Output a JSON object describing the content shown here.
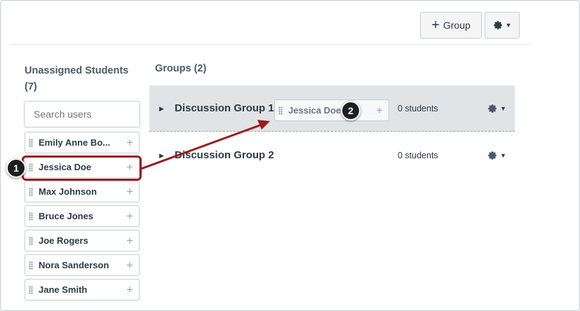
{
  "toolbar": {
    "add_group_label": "Group",
    "add_group_icon": "plus-icon",
    "settings_icon": "gear-icon"
  },
  "unassigned": {
    "title": "Unassigned Students (7)",
    "search_placeholder": "Search users",
    "students": [
      {
        "name": "Emily Anne Bo..."
      },
      {
        "name": "Jessica Doe"
      },
      {
        "name": "Max Johnson"
      },
      {
        "name": "Bruce Jones"
      },
      {
        "name": "Joe Rogers"
      },
      {
        "name": "Nora Sanderson"
      },
      {
        "name": "Jane Smith"
      }
    ],
    "add_symbol": "+"
  },
  "groups": {
    "title": "Groups (2)",
    "items": [
      {
        "name": "Discussion Group 1",
        "count": "0 students"
      },
      {
        "name": "Discussion Group 2",
        "count": "0 students"
      }
    ],
    "dragging_student": "Jessica Doe"
  },
  "callouts": [
    "1",
    "2"
  ],
  "colors": {
    "highlight": "#9b1b1f",
    "callout_bg": "#1e1e1e",
    "group_row_active": "#e1e4e7"
  }
}
